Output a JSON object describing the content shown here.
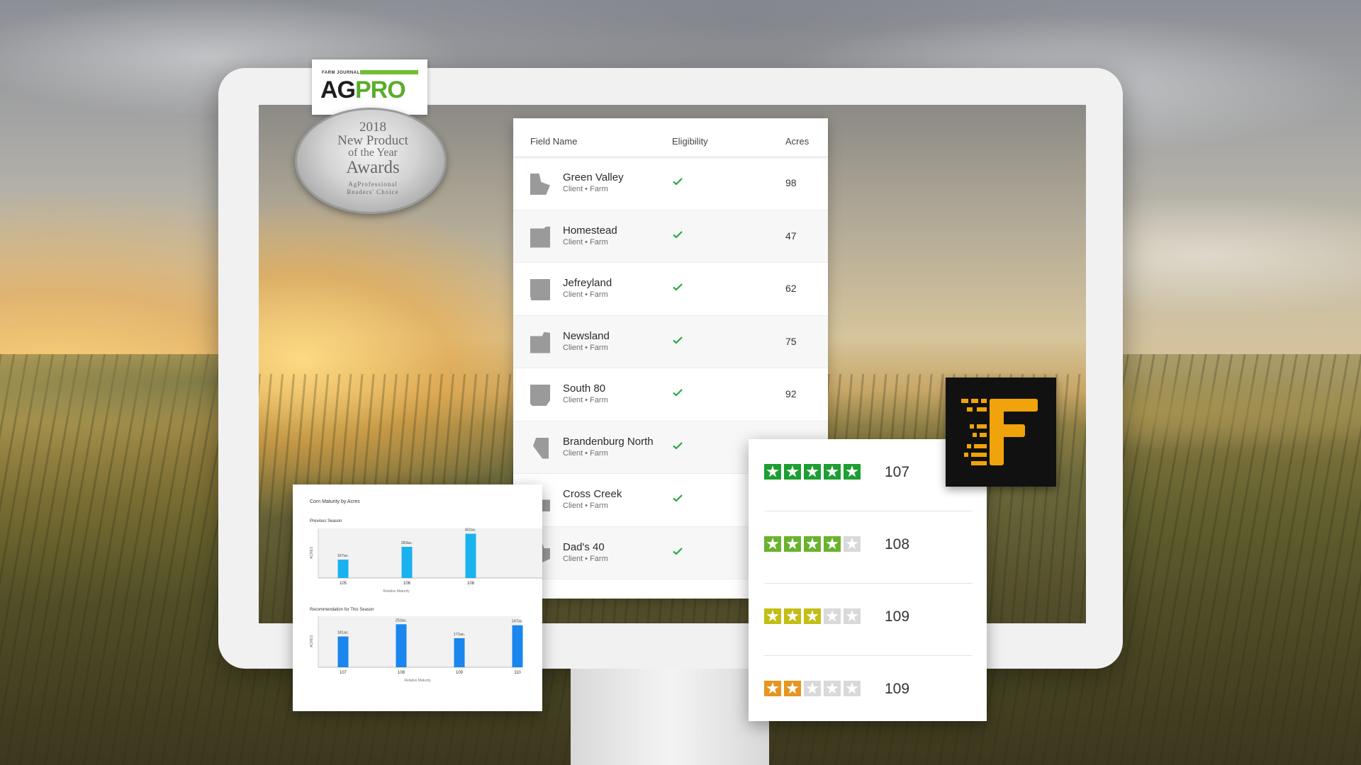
{
  "award": {
    "brand_top": "FARM JOURNAL'S",
    "brand_ag": "AG",
    "brand_pro": "PRO",
    "year": "2018",
    "line1": "New Product",
    "line2": "of the Year",
    "line3": "Awards",
    "line4": "AgProfessional",
    "line5": "Readers' Choice"
  },
  "fields_table": {
    "headers": {
      "name": "Field Name",
      "eligibility": "Eligibility",
      "acres": "Acres"
    },
    "rows": [
      {
        "name": "Green Valley",
        "meta": "Client  •  Farm",
        "eligible": true,
        "acres": "98"
      },
      {
        "name": "Homestead",
        "meta": "Client  •  Farm",
        "eligible": true,
        "acres": "47"
      },
      {
        "name": "Jefreyland",
        "meta": "Client  •  Farm",
        "eligible": true,
        "acres": "62"
      },
      {
        "name": "Newsland",
        "meta": "Client  •  Farm",
        "eligible": true,
        "acres": "75"
      },
      {
        "name": "South 80",
        "meta": "Client  •  Farm",
        "eligible": true,
        "acres": "92"
      },
      {
        "name": "Brandenburg North",
        "meta": "Client  •  Farm",
        "eligible": true,
        "acres": ""
      },
      {
        "name": "Cross Creek",
        "meta": "Client  •  Farm",
        "eligible": true,
        "acres": ""
      },
      {
        "name": "Dad's 40",
        "meta": "Client  •  Farm",
        "eligible": true,
        "acres": ""
      }
    ]
  },
  "ratings": [
    {
      "stars": 5,
      "value": "107",
      "color": "#1e9e33"
    },
    {
      "stars": 4,
      "value": "108",
      "color": "#6bb22f"
    },
    {
      "stars": 3,
      "value": "109",
      "color": "#c3bd14"
    },
    {
      "stars": 2,
      "value": "109",
      "color": "#e59620"
    }
  ],
  "logo": {
    "icon": "speed-f-logo-icon",
    "color": "#f0a30a"
  },
  "colors": {
    "check": "#2aa84a",
    "bar_previous": "#1ab2ee",
    "bar_recommended": "#1a86ee"
  },
  "chart_data": [
    {
      "type": "bar",
      "title": "Corn Maturity by Acres",
      "subtitle": "Previous Season",
      "xlabel": "Relative Maturity",
      "ylabel": "ACRES",
      "categories": [
        "105",
        "106",
        "108"
      ],
      "values": [
        167,
        283,
        402
      ],
      "labels": [
        "167ac.",
        "283ac.",
        "402ac."
      ],
      "ylim": [
        0,
        450
      ]
    },
    {
      "type": "bar",
      "subtitle": "Recommendation for This Season",
      "xlabel": "Relative Maturity",
      "ylabel": "ACRES",
      "categories": [
        "107",
        "108",
        "109",
        "110"
      ],
      "values": [
        181,
        253,
        171,
        247
      ],
      "labels": [
        "181ac.",
        "253ac.",
        "171ac.",
        "247ac."
      ],
      "ylim": [
        0,
        300
      ]
    }
  ]
}
